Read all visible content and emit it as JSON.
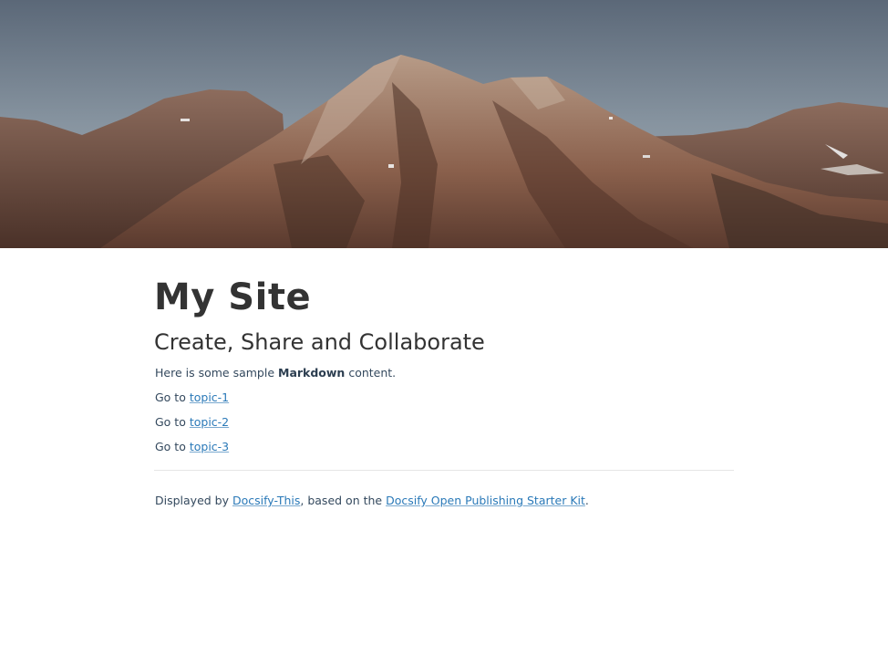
{
  "hero": {
    "icon": "mountain-banner-image"
  },
  "page": {
    "title": "My Site",
    "subtitle": "Create, Share and Collaborate",
    "intro": {
      "prefix": "Here is some sample ",
      "bold": "Markdown",
      "suffix": " content."
    },
    "links": [
      {
        "prefix": "Go to ",
        "label": "topic-1"
      },
      {
        "prefix": "Go to ",
        "label": "topic-2"
      },
      {
        "prefix": "Go to ",
        "label": "topic-3"
      }
    ],
    "footer": {
      "prefix": "Displayed by ",
      "link1": "Docsify-This",
      "middle": ", based on the ",
      "link2": "Docsify Open Publishing Starter Kit",
      "suffix": "."
    }
  },
  "colors": {
    "link": "#2a79b8",
    "heading": "#333333",
    "text": "#34495e"
  }
}
